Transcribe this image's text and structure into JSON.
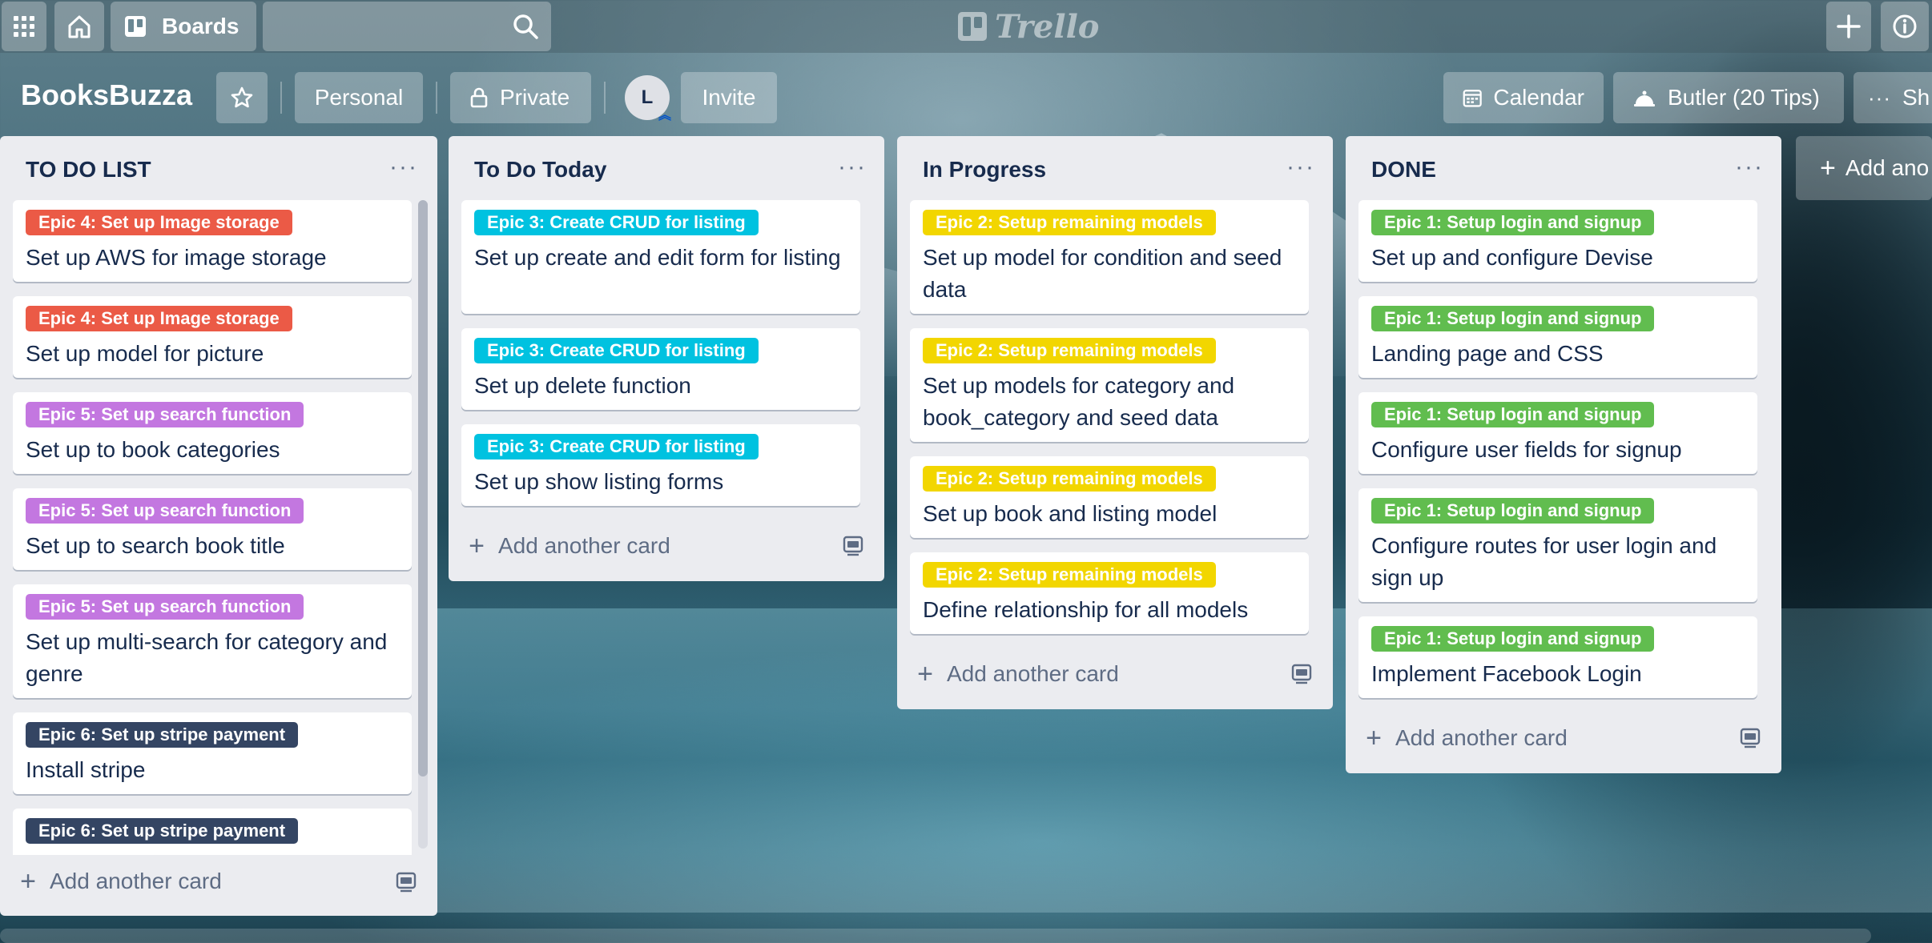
{
  "topbar": {
    "boards_label": "Boards",
    "logo_text": "Trello"
  },
  "board": {
    "title": "BooksBuzza",
    "personal_label": "Personal",
    "private_label": "Private",
    "avatar_initial": "L",
    "invite_label": "Invite",
    "calendar_label": "Calendar",
    "butler_label": "Butler (20 Tips)",
    "show_menu_label": "Sh"
  },
  "colors": {
    "red": "#eb5a46",
    "sky": "#00c2e0",
    "yellow": "#f2d600",
    "green": "#61bd4f",
    "purple": "#c377e0",
    "black": "#344563"
  },
  "add_card_label": "Add another card",
  "add_list_label": "Add ano",
  "lists": [
    {
      "title": "TO DO LIST",
      "cards": [
        {
          "label": "Epic 4: Set up Image storage",
          "color": "red",
          "text": "Set up AWS for image storage"
        },
        {
          "label": "Epic 4: Set up Image storage",
          "color": "red",
          "text": "Set up model for picture"
        },
        {
          "label": "Epic 5: Set up search function",
          "color": "purple",
          "text": "Set up to book categories"
        },
        {
          "label": "Epic 5: Set up search function",
          "color": "purple",
          "text": "Set up to search book title"
        },
        {
          "label": "Epic 5: Set up search function",
          "color": "purple",
          "text": "Set up multi-search for category and genre"
        },
        {
          "label": "Epic 6: Set up stripe payment",
          "color": "black",
          "text": "Install stripe"
        },
        {
          "label": "Epic 6: Set up stripe payment",
          "color": "black",
          "text": ""
        }
      ]
    },
    {
      "title": "To Do Today",
      "cards": [
        {
          "label": "Epic 3: Create CRUD for listing",
          "color": "sky",
          "text": "Set up create and edit form for listing"
        },
        {
          "label": "Epic 3: Create CRUD for listing",
          "color": "sky",
          "text": "Set up delete function"
        },
        {
          "label": "Epic 3: Create CRUD for listing",
          "color": "sky",
          "text": "Set up show listing forms"
        }
      ]
    },
    {
      "title": "In Progress",
      "cards": [
        {
          "label": "Epic 2: Setup remaining models",
          "color": "yellow",
          "text": "Set up model for condition and seed data"
        },
        {
          "label": "Epic 2: Setup remaining models",
          "color": "yellow",
          "text": "Set up models for category and book_category and seed data"
        },
        {
          "label": "Epic 2: Setup remaining models",
          "color": "yellow",
          "text": "Set up book and listing model"
        },
        {
          "label": "Epic 2: Setup remaining models",
          "color": "yellow",
          "text": "Define relationship for all models"
        }
      ]
    },
    {
      "title": "DONE",
      "cards": [
        {
          "label": "Epic 1: Setup login and signup",
          "color": "green",
          "text": "Set up and configure Devise"
        },
        {
          "label": "Epic 1: Setup login and signup",
          "color": "green",
          "text": "Landing page and CSS"
        },
        {
          "label": "Epic 1: Setup login and signup",
          "color": "green",
          "text": "Configure user fields for signup"
        },
        {
          "label": "Epic 1: Setup login and signup",
          "color": "green",
          "text": "Configure routes for user login and sign up"
        },
        {
          "label": "Epic 1: Setup login and signup",
          "color": "green",
          "text": "Implement Facebook Login"
        }
      ]
    }
  ]
}
